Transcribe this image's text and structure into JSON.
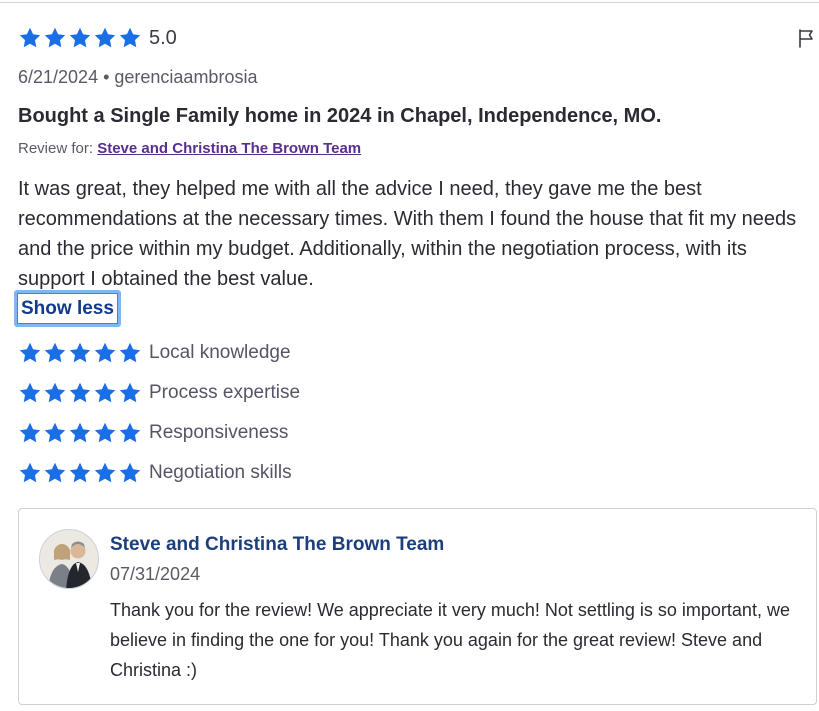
{
  "colors": {
    "star": "#1a6fe6",
    "link": "#5a2d91",
    "show_less": "#123a8c",
    "reply_name": "#1c3f7c"
  },
  "review": {
    "stars": 5,
    "rating": "5.0",
    "meta": "6/21/2024 • gerenciaambrosia",
    "title": "Bought a Single Family home in 2024 in Chapel, Independence, MO.",
    "review_for_label": "Review for: ",
    "review_for_link": "Steve and Christina The Brown Team",
    "body": "It was great, they helped me with all the advice I need, they gave me the best recommendations at the necessary times. With them I found the house that fit my needs and the price within my budget. Additionally, within the negotiation process, with its support I obtained the best value.",
    "show_less": "Show less",
    "categories": [
      {
        "label": "Local knowledge",
        "stars": 5
      },
      {
        "label": "Process expertise",
        "stars": 5
      },
      {
        "label": "Responsiveness",
        "stars": 5
      },
      {
        "label": "Negotiation skills",
        "stars": 5
      }
    ]
  },
  "reply": {
    "name": "Steve and Christina The Brown Team",
    "date": "07/31/2024",
    "body": "Thank you for the review! We appreciate it very much! Not settling is so important, we believe in finding the one for you! Thank you again for the great review! Steve and Christina :)"
  },
  "icons": {
    "star": "star-icon",
    "flag": "flag-icon",
    "avatar": "team-avatar"
  }
}
